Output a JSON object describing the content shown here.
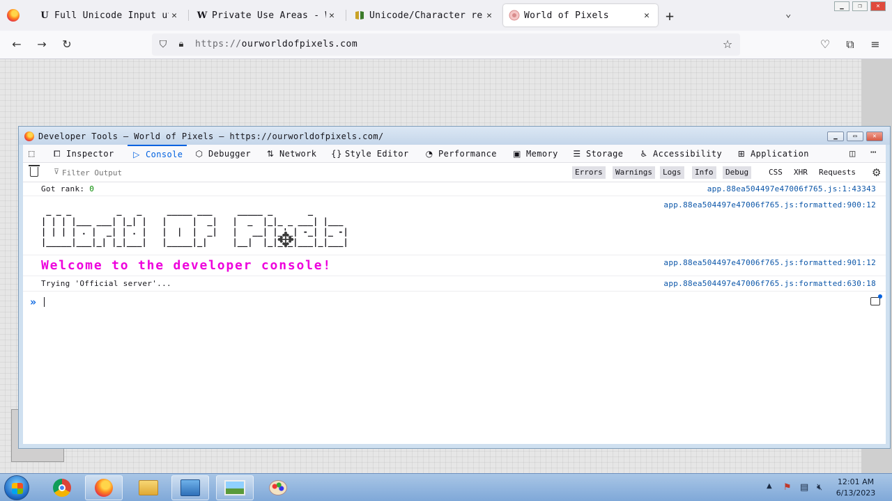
{
  "browser": {
    "tabs": [
      {
        "title": "Full Unicode Input ut",
        "favicon": "U"
      },
      {
        "title": "Private Use Areas - W",
        "favicon": "W"
      },
      {
        "title": "Unicode/Character re",
        "favicon": "wikibooks-icon"
      },
      {
        "title": "World of Pixels",
        "favicon": "wop-icon",
        "active": true
      }
    ],
    "url_protocol": "https://",
    "url_host": "ourworldofpixels.com"
  },
  "devtools": {
    "window_title": "Developer Tools — World of Pixels — https://ourworldofpixels.com/",
    "tabs": [
      {
        "label": "Inspector",
        "icon": "inspector-icon"
      },
      {
        "label": "Console",
        "icon": "console-icon",
        "active": true
      },
      {
        "label": "Debugger",
        "icon": "debugger-icon"
      },
      {
        "label": "Network",
        "icon": "network-icon"
      },
      {
        "label": "Style Editor",
        "icon": "style-editor-icon"
      },
      {
        "label": "Performance",
        "icon": "performance-icon"
      },
      {
        "label": "Memory",
        "icon": "memory-icon"
      },
      {
        "label": "Storage",
        "icon": "storage-icon"
      },
      {
        "label": "Accessibility",
        "icon": "accessibility-icon"
      },
      {
        "label": "Application",
        "icon": "application-icon"
      }
    ],
    "filter_placeholder": "Filter Output",
    "filter_levels": [
      "Errors",
      "Warnings",
      "Logs",
      "Info",
      "Debug"
    ],
    "filter_types": [
      "CSS",
      "XHR",
      "Requests"
    ],
    "logs": [
      {
        "prefix": "Got rank: ",
        "value": "0",
        "source": "app.88ea504497e47006f765.js:1:43343"
      },
      {
        "ascii": [
          " _ _ _         _   _     _____ ___     _____ _       _",
          "| | | |___ ___| |_| |   |     |  _|   |  _  |_|_ _ ___| |___",
          "| | | | . |  _| | . |   |  |  |  _|   |   __| |_'_| -_| |_ -|",
          "|_____|___|_| |_|___|   |_____|_|     |__|  |_|_,_|___|_|___|"
        ],
        "source": "app.88ea504497e47006f765.js:formatted:900:12"
      },
      {
        "message": "Welcome to the developer console!",
        "source": "app.88ea504497e47006f765.js:formatted:901:12"
      },
      {
        "message": "Trying 'Official server'...",
        "source": "app.88ea504497e47006f765.js:formatted:630:18"
      }
    ],
    "prompt": "»"
  },
  "taskbar": {
    "time": "12:01 AM",
    "date": "6/13/2023"
  },
  "colors": {
    "accent": "#0061e0",
    "welcome": "#ee00dd",
    "source_link": "#0a55a8"
  }
}
